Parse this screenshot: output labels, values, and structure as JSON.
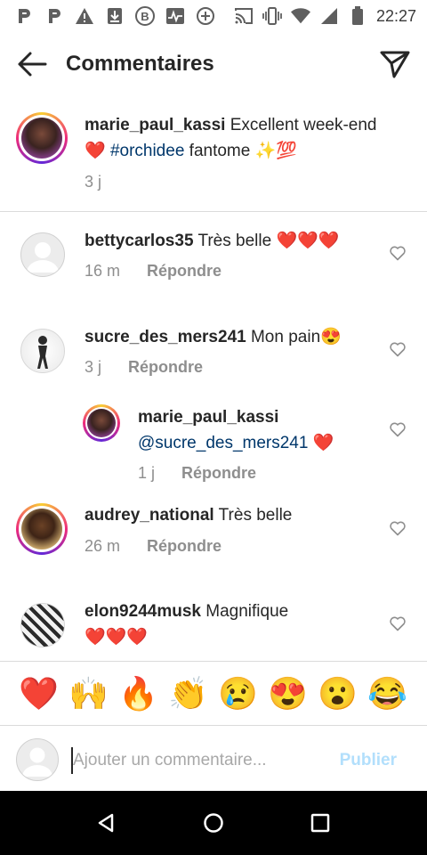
{
  "status_bar": {
    "time": "22:27",
    "icons": [
      "p-app-icon",
      "p-app-icon",
      "warning-icon",
      "download-icon",
      "bitcoin-icon",
      "activity-icon",
      "add-circle-icon",
      "cast-icon",
      "vibrate-icon",
      "wifi-icon",
      "signal-icon",
      "battery-icon"
    ]
  },
  "header": {
    "title": "Commentaires",
    "back_icon": "arrow-left-icon",
    "send_icon": "send-icon"
  },
  "caption": {
    "username": "marie_paul_kassi",
    "text_before": " Excellent week-end ❤️ ",
    "hashtag": "#orchidee",
    "text_after": " fantome ✨💯",
    "time": "3 j"
  },
  "comments": [
    {
      "username": "bettycarlos35",
      "text": " Très belle ❤️❤️❤️",
      "time": "16 m",
      "reply_label": "Répondre"
    },
    {
      "username": "sucre_des_mers241",
      "text": " Mon pain😍",
      "time": "3 j",
      "reply_label": "Répondre"
    },
    {
      "username": "marie_paul_kassi",
      "mention": "@sucre_des_mers241",
      "text": " ❤️",
      "time": "1 j",
      "reply_label": "Répondre"
    },
    {
      "username": "audrey_national",
      "text": " Très belle",
      "time": "26 m",
      "reply_label": "Répondre"
    },
    {
      "username": "elon9244musk",
      "text": " Magnifique",
      "text_line2": "❤️❤️❤️"
    }
  ],
  "emoji_bar": [
    "❤️",
    "🙌",
    "🔥",
    "👏",
    "😢",
    "😍",
    "😮",
    "😂"
  ],
  "input": {
    "placeholder": "Ajouter un commentaire...",
    "publish_label": "Publier"
  },
  "colors": {
    "link": "#00376b",
    "muted": "#8e8e8e",
    "publish_disabled": "#b2dffc",
    "divider": "#dbdbdb"
  }
}
